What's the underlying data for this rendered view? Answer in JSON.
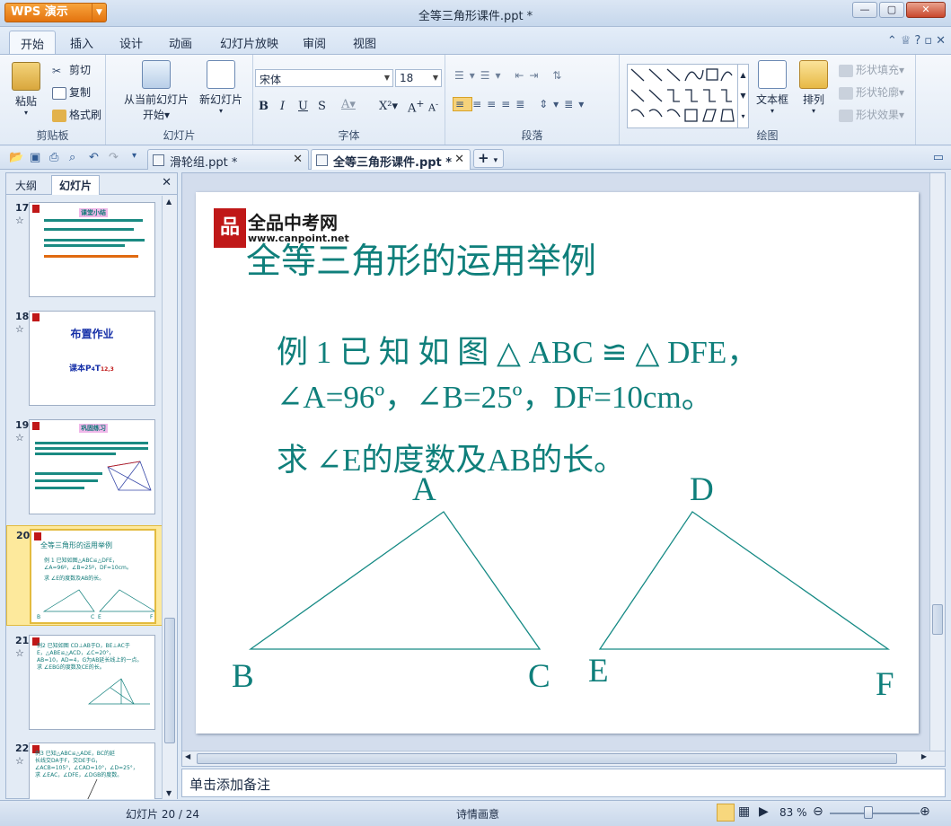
{
  "window": {
    "app_button": "WPS 演示",
    "title": "全等三角形课件.ppt *",
    "minimize": "—",
    "maximize": "▢",
    "close": "✕"
  },
  "menu_tabs": [
    "开始",
    "插入",
    "设计",
    "动画",
    "幻灯片放映",
    "审阅",
    "视图"
  ],
  "ribbon": {
    "clipboard": {
      "paste": "粘贴",
      "cut": "剪切",
      "copy": "复制",
      "format_painter": "格式刷",
      "label": "剪贴板"
    },
    "slides": {
      "from_current": "从当前幻灯片",
      "from_current_2": "开始",
      "new_slide": "新幻灯片",
      "label": "幻灯片"
    },
    "font": {
      "name": "宋体",
      "size": "18",
      "label": "字体"
    },
    "paragraph": {
      "label": "段落"
    },
    "drawing": {
      "textbox": "文本框",
      "arrange": "排列",
      "shape_fill": "形状填充",
      "shape_outline": "形状轮廓",
      "shape_effect": "形状效果",
      "label": "绘图"
    }
  },
  "doc_tabs": [
    {
      "name": "滑轮组.ppt *"
    },
    {
      "name": "全等三角形课件.ppt *"
    }
  ],
  "panel": {
    "tab_outline": "大纲",
    "tab_slides": "幻灯片"
  },
  "thumbnails": [
    {
      "num": "17",
      "title": "课堂小结"
    },
    {
      "num": "18",
      "title": "布置作业",
      "body": "课本P",
      "body2": "T",
      "body3": "12,3"
    },
    {
      "num": "19",
      "title": "巩固练习"
    },
    {
      "num": "20",
      "title": "全等三角形的运用举例",
      "l1": "例 1  已知如图△ABC≌△DFE，",
      "l2": "∠A=96º，∠B=25º，DF=10cm。",
      "l3": "求 ∠E的度数及AB的长。"
    },
    {
      "num": "21",
      "l1": "例2 已知如图 CD⊥AB于D，BE⊥AC于",
      "l2": "E，△ABE≌△ACD，∠C=20°，",
      "l3": "AB=10，AD=4，G为AB延长线上的一点。",
      "l4": "求 ∠EBG的度数及CE的长。"
    },
    {
      "num": "22",
      "l1": "例3 已知△ABC≌△ADE，BC的延",
      "l2": "长线交DA于F，交DE于G，",
      "l3": "∠ACB=105°，∠CAD=10°，∠D=25°，",
      "l4": "求 ∠EAC，∠DFE，∠DGB的度数。"
    }
  ],
  "slide": {
    "logo_text": "全品中考网",
    "logo_url": "www.canpoint.net",
    "title": "全等三角形的运用举例",
    "line1": "例 1   已 知 如 图 △ ABC ≌ △ DFE，",
    "line2": "∠A=96º，∠B=25º，DF=10cm。",
    "line3": "求  ∠E的度数及AB的长。",
    "labels": {
      "A": "A",
      "B": "B",
      "C": "C",
      "D": "D",
      "E": "E",
      "F": "F"
    }
  },
  "notes_placeholder": "单击添加备注",
  "status": {
    "slide_counter": "幻灯片 20 / 24",
    "theme": "诗情画意",
    "zoom": "83 %"
  }
}
